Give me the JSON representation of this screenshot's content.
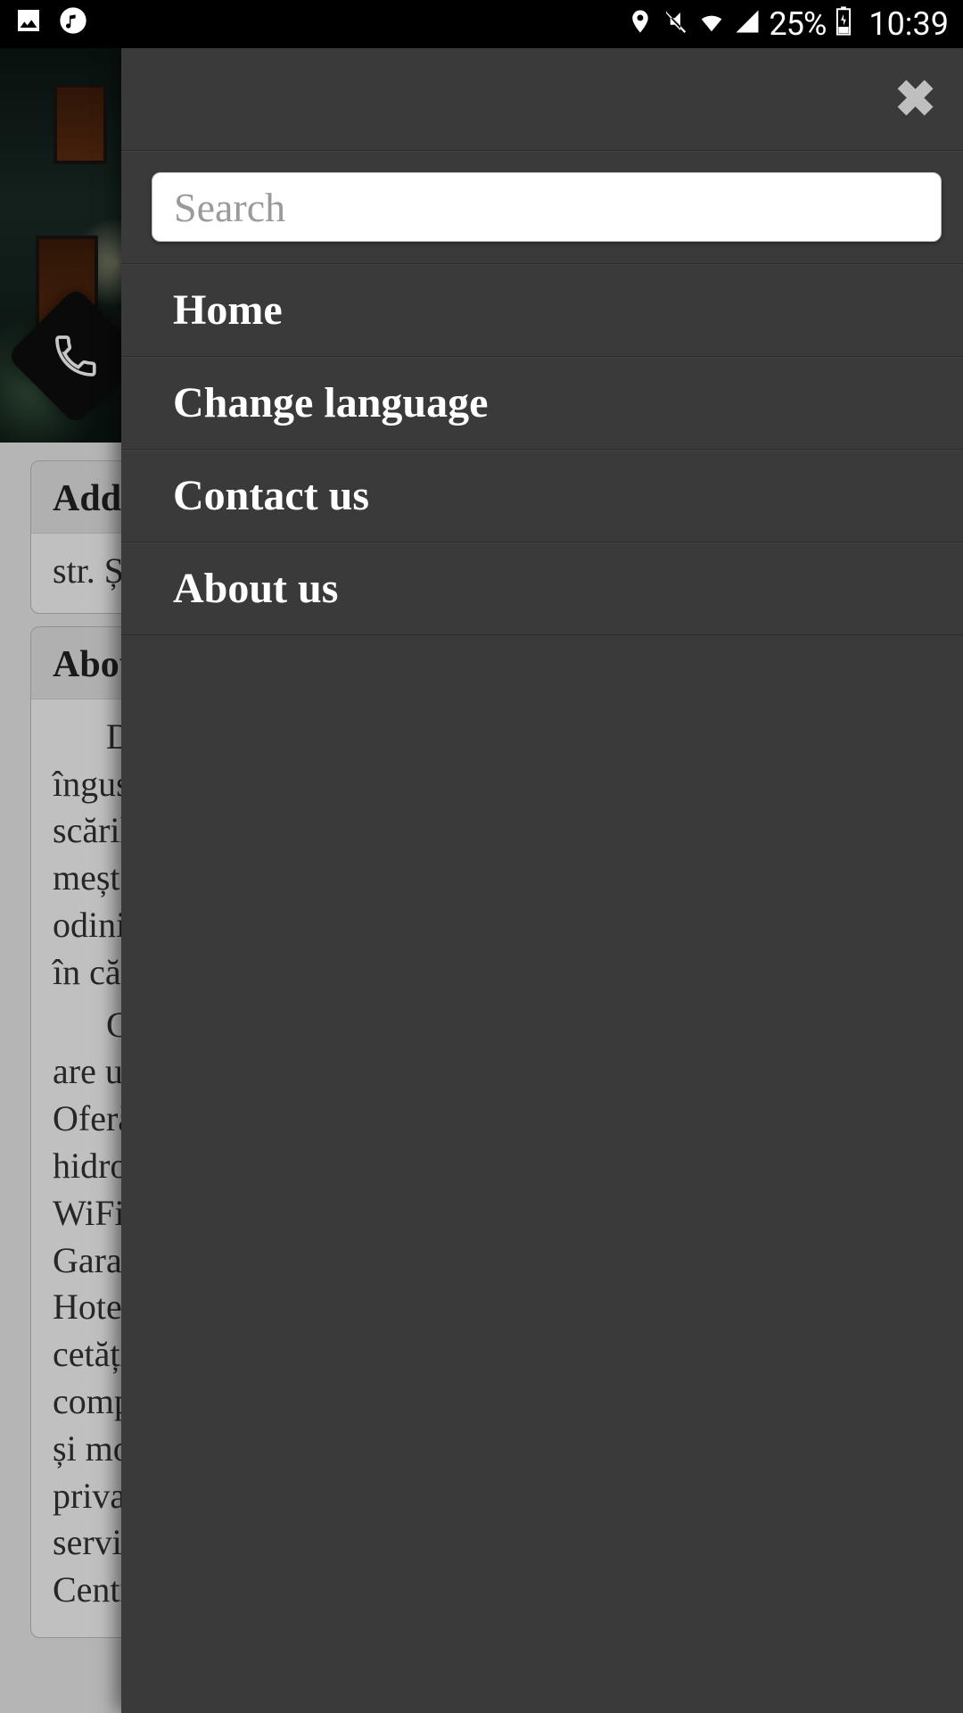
{
  "status": {
    "battery_percent": "25%",
    "time": "10:39"
  },
  "page": {
    "address_heading": "Addre",
    "address_value": "str. Șc",
    "about_heading": "About",
    "about_paragraph_1": "D\nîngust\nscările\nmește\nodinio\nîn cău",
    "about_paragraph_2": "C\nare un\nOferă\nhidron\nWiFi. S\nGara S\nHotelu\ncetății\ncompa\nși mob\nprivata\nservic\nCentru"
  },
  "drawer": {
    "search_placeholder": "Search",
    "items": [
      "Home",
      "Change language",
      "Contact us",
      "About us"
    ]
  }
}
